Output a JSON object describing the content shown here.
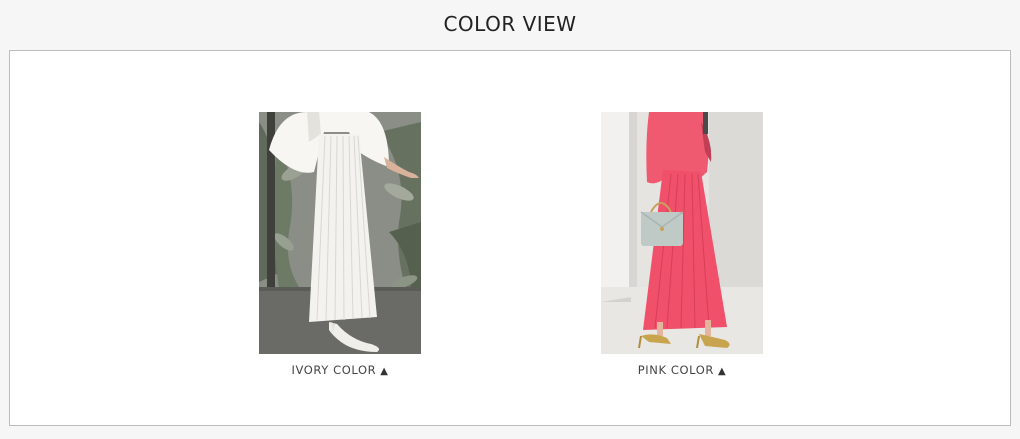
{
  "header": {
    "title": "COLOR VIEW"
  },
  "colors": {
    "background": "#f6f6f6",
    "frame_border": "#bdbdbd",
    "text": "#444444"
  },
  "products": [
    {
      "caption": "IVORY COLOR",
      "arrow_icon": "triangle-up-icon",
      "garment_color": "#f3f2ee"
    },
    {
      "caption": "PINK COLOR",
      "arrow_icon": "triangle-up-icon",
      "garment_color": "#f0506a"
    }
  ]
}
